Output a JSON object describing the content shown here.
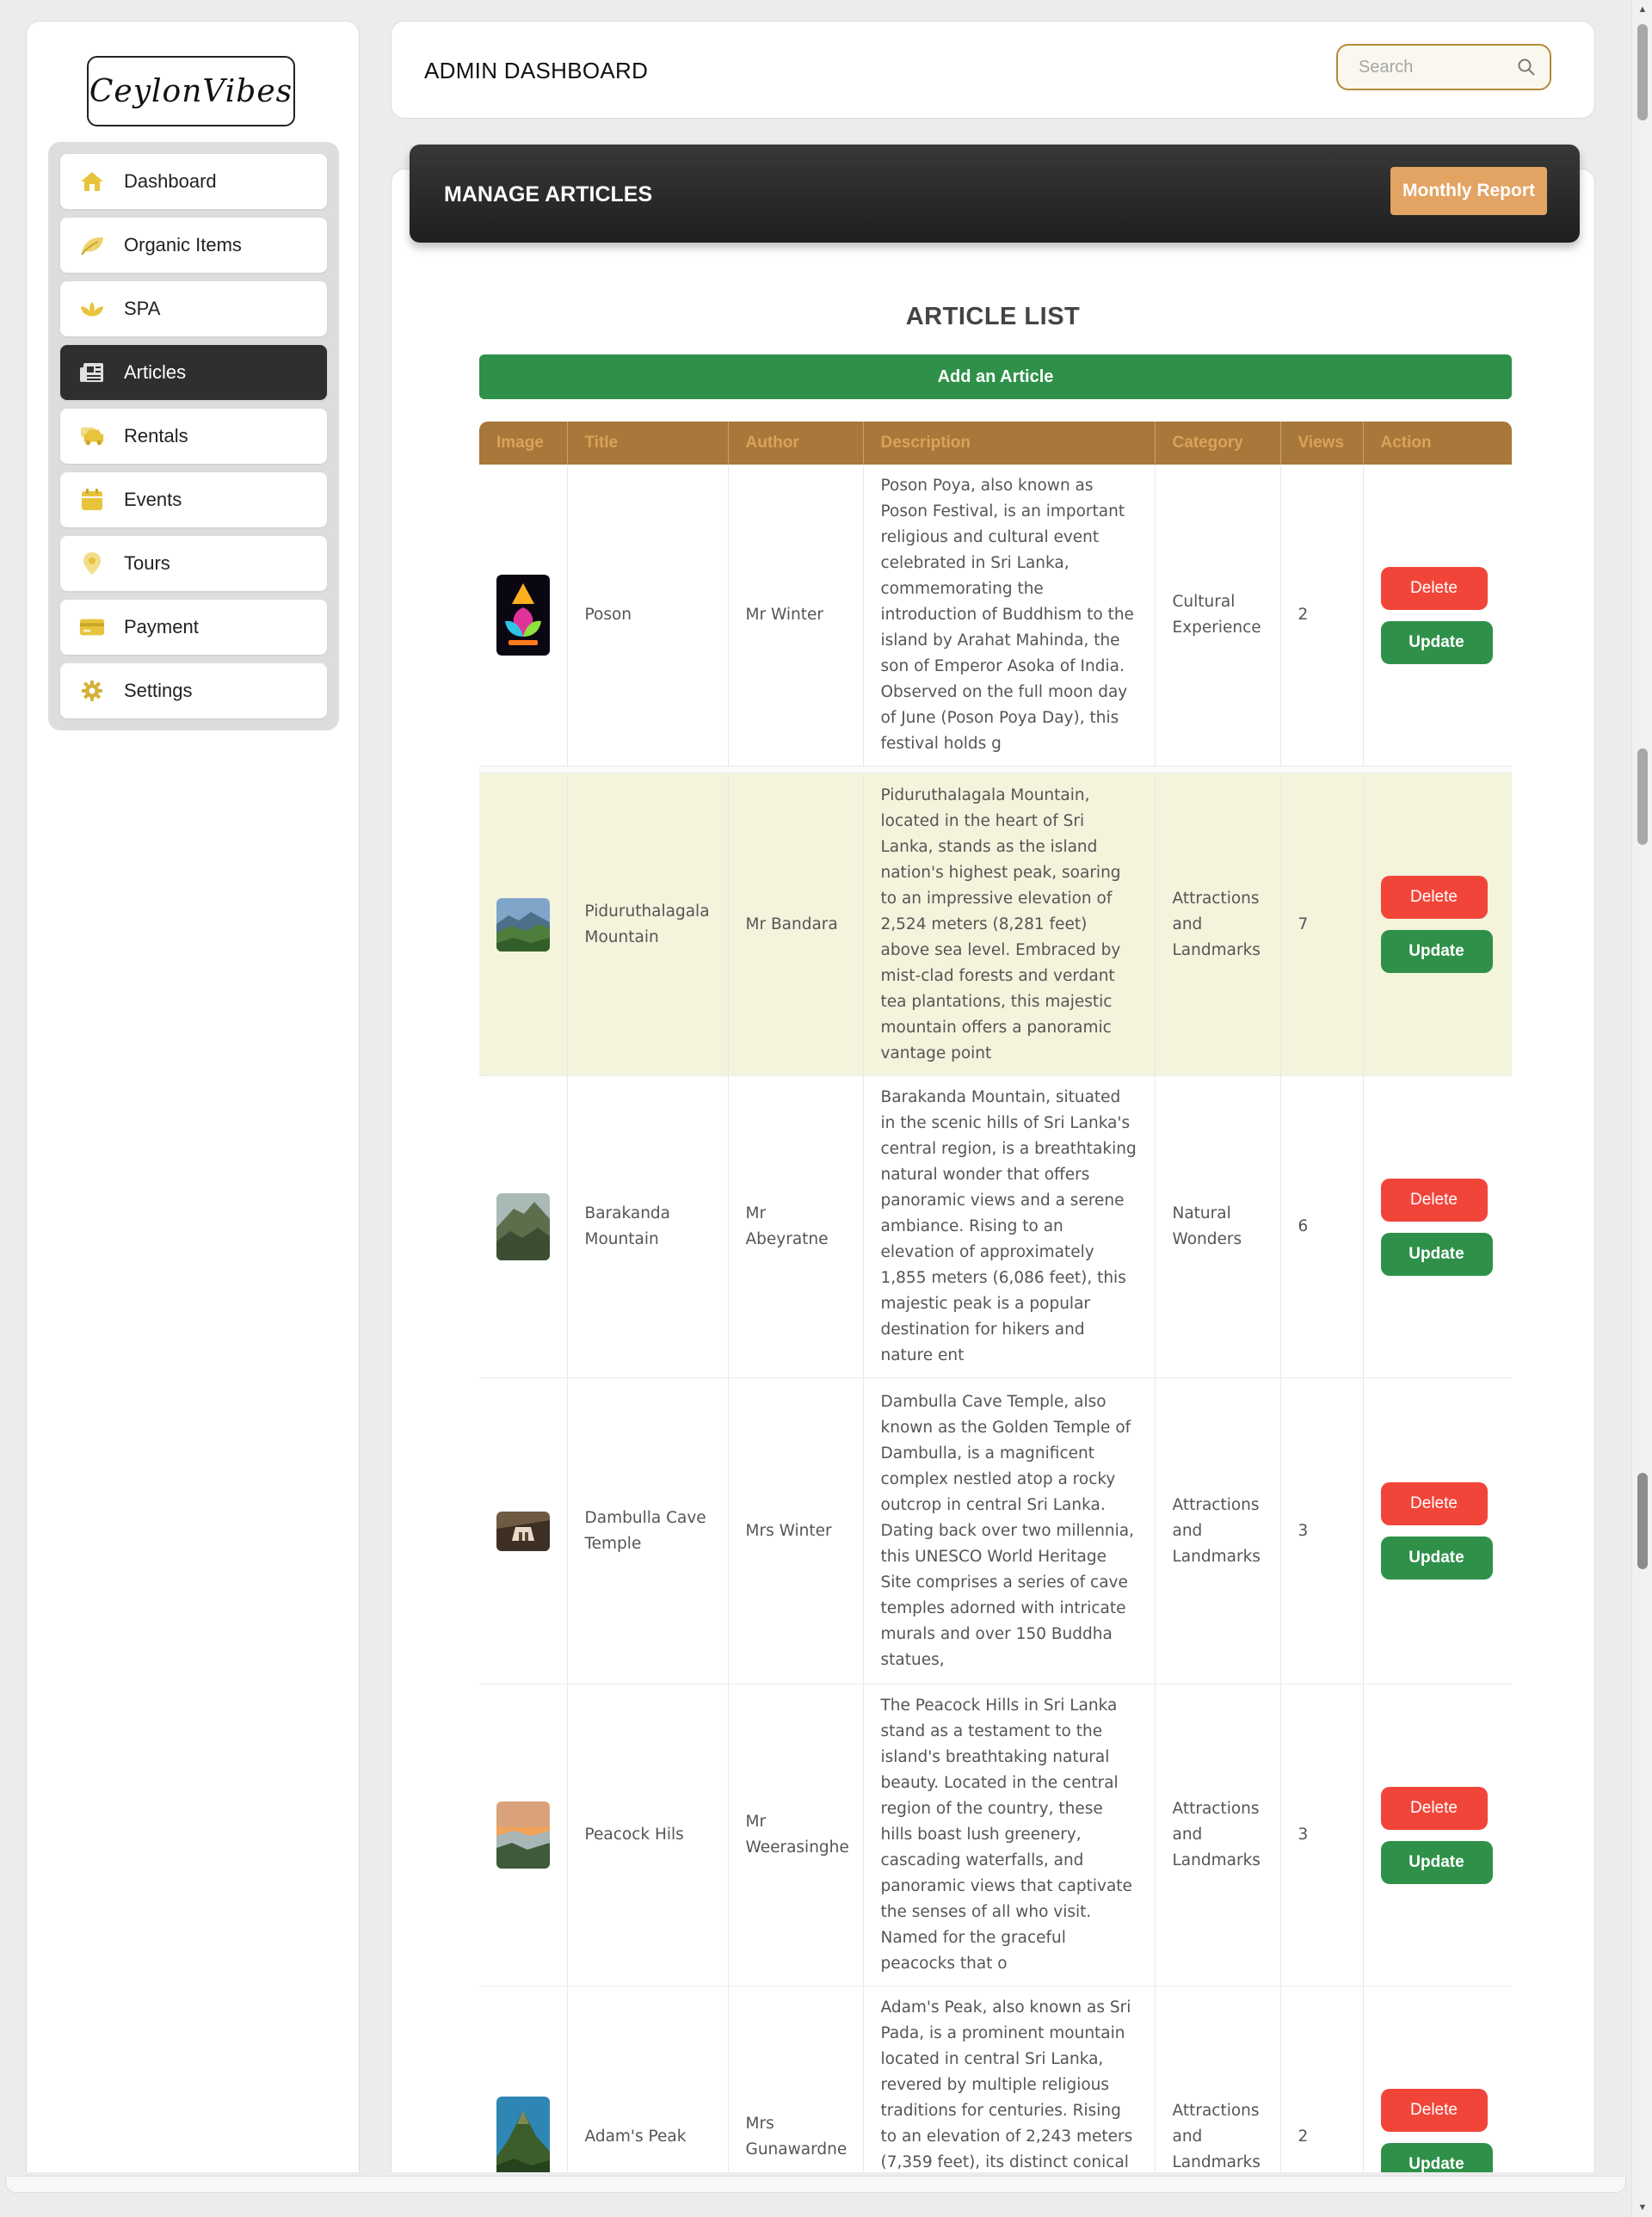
{
  "brand": {
    "logo_text": "CeylonVibes"
  },
  "sidebar": {
    "items": [
      {
        "label": "Dashboard",
        "icon": "home-icon",
        "active": false
      },
      {
        "label": "Organic Items",
        "icon": "leaf-icon",
        "active": false
      },
      {
        "label": "SPA",
        "icon": "lotus-icon",
        "active": false
      },
      {
        "label": "Articles",
        "icon": "newspaper-icon",
        "active": true
      },
      {
        "label": "Rentals",
        "icon": "car-icon",
        "active": false
      },
      {
        "label": "Events",
        "icon": "calendar-icon",
        "active": false
      },
      {
        "label": "Tours",
        "icon": "map-pin-icon",
        "active": false
      },
      {
        "label": "Payment",
        "icon": "credit-card-icon",
        "active": false
      },
      {
        "label": "Settings",
        "icon": "gear-icon",
        "active": false
      }
    ]
  },
  "header": {
    "title": "ADMIN DASHBOARD",
    "search_placeholder": "Search"
  },
  "banner": {
    "title": "MANAGE ARTICLES",
    "report_button": "Monthly Report"
  },
  "list": {
    "title": "ARTICLE LIST",
    "add_button": "Add an Article"
  },
  "table": {
    "columns": [
      "Image",
      "Title",
      "Author",
      "Description",
      "Category",
      "Views",
      "Action"
    ],
    "delete_label": "Delete",
    "update_label": "Update",
    "rows": [
      {
        "title": "Poson",
        "author": "Mr Winter",
        "description": "Poson Poya, also known as Poson Festival, is an important religious and cultural event celebrated in Sri Lanka, commemorating the introduction of Buddhism to the island by Arahat Mahinda, the son of Emperor Asoka of India. Observed on the full moon day of June (Poson Poya Day), this festival holds g",
        "category": "Cultural Experience",
        "views": "2"
      },
      {
        "title": "Piduruthalagala Mountain",
        "author": "Mr Bandara",
        "description": "Piduruthalagala Mountain, located in the heart of Sri Lanka, stands as the island nation's highest peak, soaring to an impressive elevation of 2,524 meters (8,281 feet) above sea level. Embraced by mist-clad forests and verdant tea plantations, this majestic mountain offers a panoramic vantage point",
        "category": "Attractions and Landmarks",
        "views": "7"
      },
      {
        "title": "Barakanda Mountain",
        "author": "Mr Abeyratne",
        "description": "Barakanda Mountain, situated in the scenic hills of Sri Lanka's central region, is a breathtaking natural wonder that offers panoramic views and a serene ambiance. Rising to an elevation of approximately 1,855 meters (6,086 feet), this majestic peak is a popular destination for hikers and nature ent",
        "category": "Natural Wonders",
        "views": "6"
      },
      {
        "title": "Dambulla Cave Temple",
        "author": "Mrs Winter",
        "description": "Dambulla Cave Temple, also known as the Golden Temple of Dambulla, is a magnificent complex nestled atop a rocky outcrop in central Sri Lanka. Dating back over two millennia, this UNESCO World Heritage Site comprises a series of cave temples adorned with intricate murals and over 150 Buddha statues,",
        "category": "Attractions and Landmarks",
        "views": "3"
      },
      {
        "title": "Peacock Hils",
        "author": "Mr Weerasinghe",
        "description": "The Peacock Hills in Sri Lanka stand as a testament to the island's breathtaking natural beauty. Located in the central region of the country, these hills boast lush greenery, cascading waterfalls, and panoramic views that captivate the senses of all who visit. Named for the graceful peacocks that o",
        "category": "Attractions and Landmarks",
        "views": "3"
      },
      {
        "title": "Adam's Peak",
        "author": "Mrs Gunawardne",
        "description": "Adam's Peak, also known as Sri Pada, is a prominent mountain located in central Sri Lanka, revered by multiple religious traditions for centuries. Rising to an elevation of 2,243 meters (7,359 feet), its distinct conical shape dominates the surrounding landscape. The peak holds immense cultural and",
        "category": "Attractions and Landmarks",
        "views": "2"
      }
    ]
  },
  "colors": {
    "accent_gold": "#a8773a",
    "report_button": "#e3a362",
    "add_green": "#2f9149",
    "delete_red": "#f2453a",
    "nav_active": "#2f2f2f",
    "icon_yellow": "#e8c33c"
  }
}
